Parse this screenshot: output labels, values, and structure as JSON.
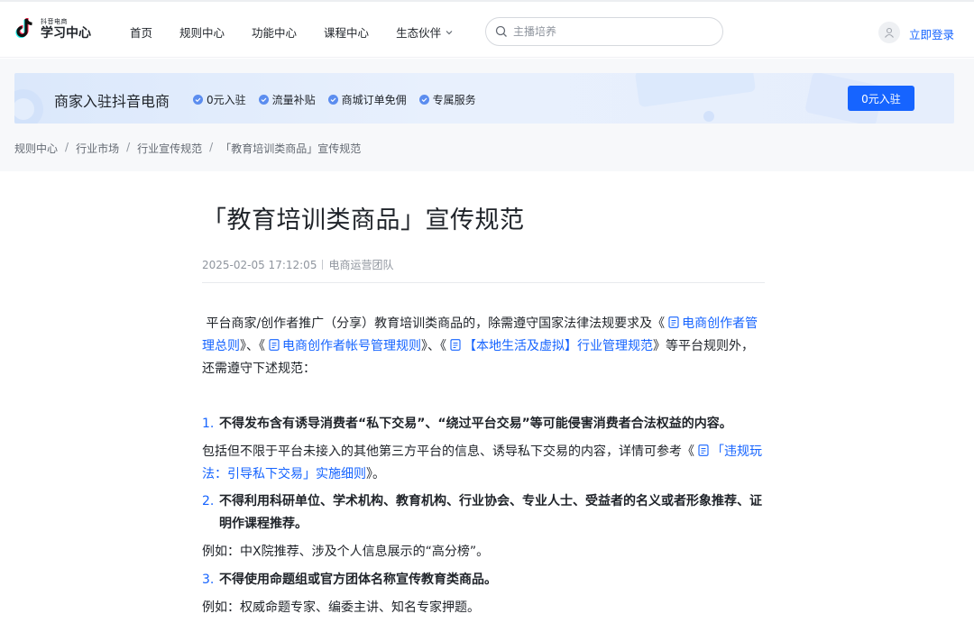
{
  "header": {
    "logo_small": "抖音电商",
    "logo_big": "学习中心",
    "nav": [
      {
        "label": "首页"
      },
      {
        "label": "规则中心"
      },
      {
        "label": "功能中心"
      },
      {
        "label": "课程中心"
      },
      {
        "label": "生态伙伴",
        "has_dropdown": true
      }
    ],
    "search_placeholder": "主播培养",
    "login_label": "立即登录"
  },
  "banner": {
    "title": "商家入驻抖音电商",
    "features": [
      "0元入驻",
      "流量补贴",
      "商城订单免佣",
      "专属服务"
    ],
    "cta_label": "0元入驻"
  },
  "breadcrumb": [
    "规则中心",
    "行业市场",
    "行业宣传规范",
    "「教育培训类商品」宣传规范"
  ],
  "article": {
    "title": "「教育培训类商品」宣传规范",
    "date": "2025-02-05 17:12:05",
    "author": "电商运营团队",
    "intro": {
      "before": "平台商家/创作者推广（分享）教育培训类商品的，除需遵守国家法律法规要求及《",
      "link1": "电商创作者管理总则",
      "mid1": "》、《",
      "link2": "电商创作者帐号管理规则",
      "mid2": "》、《",
      "link3": "【本地生活及虚拟】行业管理规范",
      "after": "》等平台规则外，还需遵守下述规范："
    },
    "rules": [
      {
        "num": "1.",
        "text": "不得发布含有诱导消费者“私下交易”、“绕过平台交易”等可能侵害消费者合法权益的内容。",
        "note_before": "包括但不限于平台未接入的其他第三方平台的信息、诱导私下交易的内容，详情可参考《",
        "note_link": "「违规玩法：引导私下交易」实施细则",
        "note_after": "》。"
      },
      {
        "num": "2.",
        "text_line1": "不得利用科研单位、学术机构、教育机构、行业协会、专业人士、受益者的名义或者形象推荐、证",
        "text_line2": "明作课程推荐。",
        "note": "例如：中X院推荐、涉及个人信息展示的“高分榜”。"
      },
      {
        "num": "3.",
        "text": "不得使用命题组或官方团体名称宣传教育类商品。",
        "note": "例如：权威命题专家、编委主讲、知名专家押题。"
      }
    ]
  },
  "colors": {
    "accent": "#1664ff",
    "text": "#1f2329",
    "muted": "#8f959e"
  }
}
